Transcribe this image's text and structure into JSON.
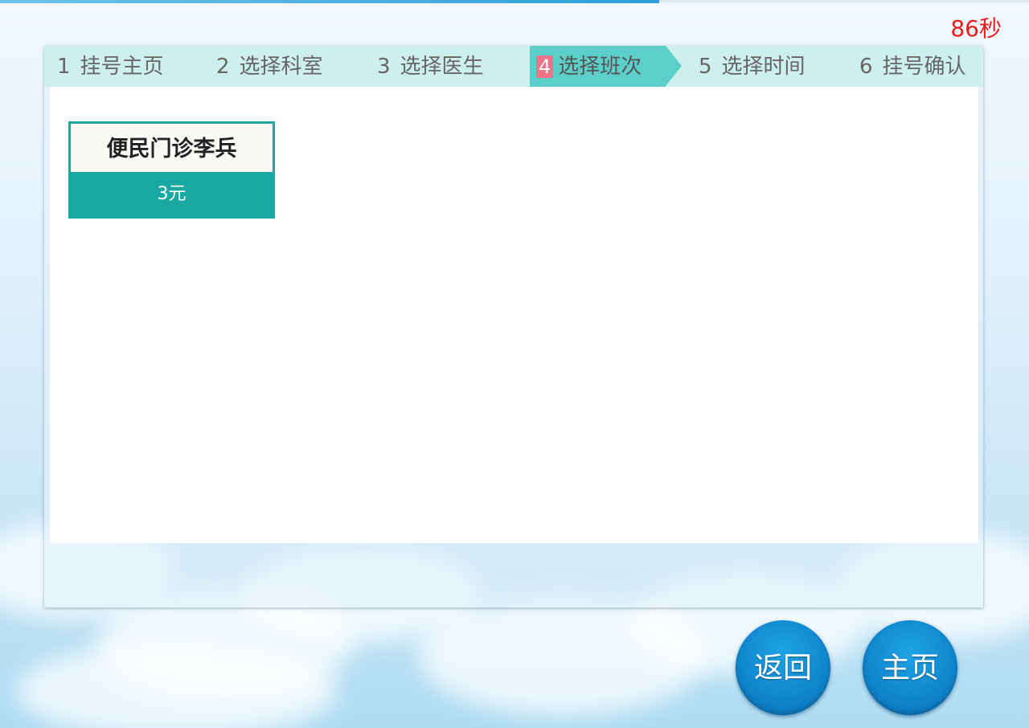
{
  "timer": {
    "text": "86秒"
  },
  "steps": [
    {
      "num": "1",
      "label": "挂号主页"
    },
    {
      "num": "2",
      "label": "选择科室"
    },
    {
      "num": "3",
      "label": "选择医生"
    },
    {
      "num": "4",
      "label": "选择班次",
      "active": true
    },
    {
      "num": "5",
      "label": "选择时间"
    },
    {
      "num": "6",
      "label": "挂号确认"
    }
  ],
  "schedule_cards": [
    {
      "name": "便民门诊李兵",
      "price": "3元"
    }
  ],
  "buttons": {
    "back_label": "返回",
    "home_label": "主页"
  },
  "colors": {
    "accent_teal": "#1aa9a2",
    "active_step": "#5ccfca",
    "step_bar": "#cdf0ee",
    "active_number_badge": "#ef7288",
    "timer_red": "#ee1b1b",
    "button_blue": "#0f84cc"
  }
}
